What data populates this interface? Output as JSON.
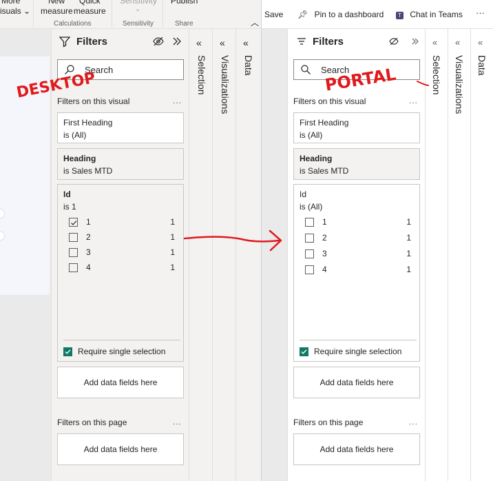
{
  "desktop": {
    "ribbon": {
      "more_visuals_top": "More",
      "more_visuals_bottom": "isuals",
      "new_measure_top": "New",
      "new_measure_bottom": "measure",
      "quick_measure_top": "Quick",
      "quick_measure_bottom": "measure",
      "calculations_group": "Calculations",
      "sensitivity_top": "Sensitivity",
      "sensitivity_group": "Sensitivity",
      "publish_top": "Publish",
      "share_group": "Share"
    },
    "filters": {
      "title": "Filters",
      "search_placeholder": "Search",
      "section_visual": "Filters on this visual",
      "section_page": "Filters on this page",
      "more": "...",
      "card1": {
        "name": "First Heading",
        "value": "is (All)"
      },
      "card2": {
        "name": "Heading",
        "value": "is Sales MTD"
      },
      "card3": {
        "name": "Id",
        "value": "is 1",
        "options": [
          {
            "label": "1",
            "count": "1",
            "checked": true
          },
          {
            "label": "2",
            "count": "1",
            "checked": false
          },
          {
            "label": "3",
            "count": "1",
            "checked": false
          },
          {
            "label": "4",
            "count": "1",
            "checked": false
          }
        ],
        "require_single": "Require single selection"
      },
      "add_fields": "Add data fields here"
    },
    "tabs": [
      "Selection",
      "Visualizations",
      "Data"
    ]
  },
  "portal": {
    "toolbar": {
      "save": "Save",
      "pin": "Pin to a dashboard",
      "chat": "Chat in Teams",
      "more": "···"
    },
    "filters": {
      "title": "Filters",
      "search_placeholder": "Search",
      "section_visual": "Filters on this visual",
      "section_page": "Filters on this page",
      "more": "...",
      "card1": {
        "name": "First Heading",
        "value": "is (All)"
      },
      "card2": {
        "name": "Heading",
        "value": "is Sales MTD"
      },
      "card3": {
        "name": "Id",
        "value": "is (All)",
        "options": [
          {
            "label": "1",
            "count": "1",
            "checked": false
          },
          {
            "label": "2",
            "count": "1",
            "checked": false
          },
          {
            "label": "3",
            "count": "1",
            "checked": false
          },
          {
            "label": "4",
            "count": "1",
            "checked": false
          }
        ],
        "require_single": "Require single selection"
      },
      "add_fields": "Add data fields here"
    },
    "tabs": [
      "Selection",
      "Visualizations",
      "Data"
    ]
  },
  "annotations": {
    "desktop_label": "DESKTOP",
    "portal_label": "PORTAL",
    "color": "#e0191c"
  },
  "colors": {
    "accent_check": "#117865",
    "pane_bg": "#f3f2f1"
  }
}
